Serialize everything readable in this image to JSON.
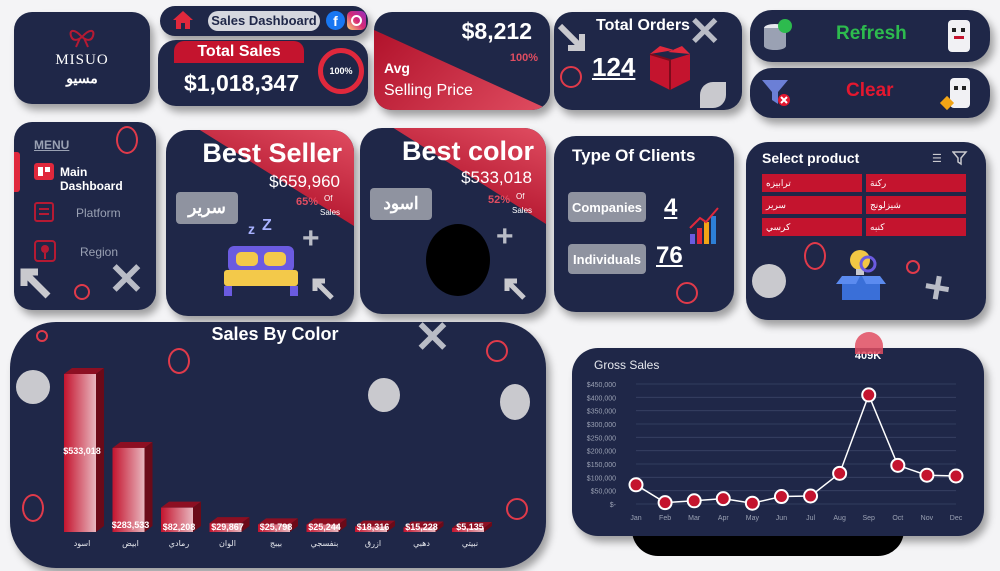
{
  "logo": {
    "latin": "MISUO",
    "arabic": "مسيو"
  },
  "header": {
    "title": "Sales Dashboard"
  },
  "total_sales": {
    "label": "Total Sales",
    "value": "$1,018,347",
    "gauge": "100%"
  },
  "avg_price": {
    "value": "$8,212",
    "percent": "100%",
    "label1": "Avg",
    "label2": "Selling Price"
  },
  "total_orders": {
    "label": "Total Orders",
    "value": "124"
  },
  "buttons": {
    "refresh": "Refresh",
    "clear": "Clear"
  },
  "menu": {
    "title": "MENU",
    "items": [
      {
        "label": "Main Dashboard"
      },
      {
        "label": "Platform"
      },
      {
        "label": "Region"
      }
    ]
  },
  "best_seller": {
    "title": "Best Seller",
    "value": "$659,960",
    "percent": "65%",
    "of": "Of",
    "sales": "Sales",
    "item": "سرير"
  },
  "best_color": {
    "title": "Best color",
    "value": "$533,018",
    "percent": "52%",
    "of": "Of",
    "sales": "Sales",
    "item": "اسود"
  },
  "clients": {
    "title": "Type Of Clients",
    "rows": [
      {
        "label": "Companies",
        "value": "4"
      },
      {
        "label": "Individuals",
        "value": "76"
      }
    ]
  },
  "product": {
    "title": "Select product",
    "items": [
      "ترابيزه",
      "ركنة",
      "سرير",
      "شيزلونج",
      "كرسي",
      "كنبه"
    ]
  },
  "colors": {
    "card": "#1f2748",
    "accent_red": "#c4142e",
    "refresh_green": "#2dbb4e",
    "clear_red": "#e3172f",
    "pill_grey": "#8f93a0"
  },
  "chart_data": [
    {
      "type": "bar",
      "title": "Sales By Color",
      "categories": [
        "اسود",
        "ابيض",
        "رمادي",
        "الوان",
        "بيبج",
        "بنفسجي",
        "ازرق",
        "دهبي",
        "نبيتي"
      ],
      "values": [
        533018,
        283533,
        82208,
        29867,
        25798,
        25244,
        18316,
        15228,
        5135
      ],
      "labels": [
        "$533,018",
        "$283,533",
        "$82,208",
        "$29,867",
        "$25,798",
        "$25,244",
        "$18,316",
        "$15,228",
        "$5,135"
      ],
      "ylim": [
        0,
        533018
      ],
      "grid": false,
      "legend": "none"
    },
    {
      "type": "line",
      "title": "Gross Sales",
      "x": [
        "Jan",
        "Feb",
        "Mar",
        "Apr",
        "May",
        "Jun",
        "Jul",
        "Aug",
        "Sep",
        "Oct",
        "Nov",
        "Dec"
      ],
      "values": [
        72000,
        5000,
        12000,
        20000,
        3000,
        28000,
        30000,
        115000,
        409000,
        145000,
        108000,
        105000
      ],
      "yticks": [
        "$450,000",
        "$400,000",
        "$350,000",
        "$300,000",
        "$250,000",
        "$200,000",
        "$150,000",
        "$100,000",
        "$50,000",
        "$-"
      ],
      "ylim": [
        0,
        450000
      ],
      "peak_label": "409K",
      "grid": true,
      "legend": "none"
    }
  ]
}
